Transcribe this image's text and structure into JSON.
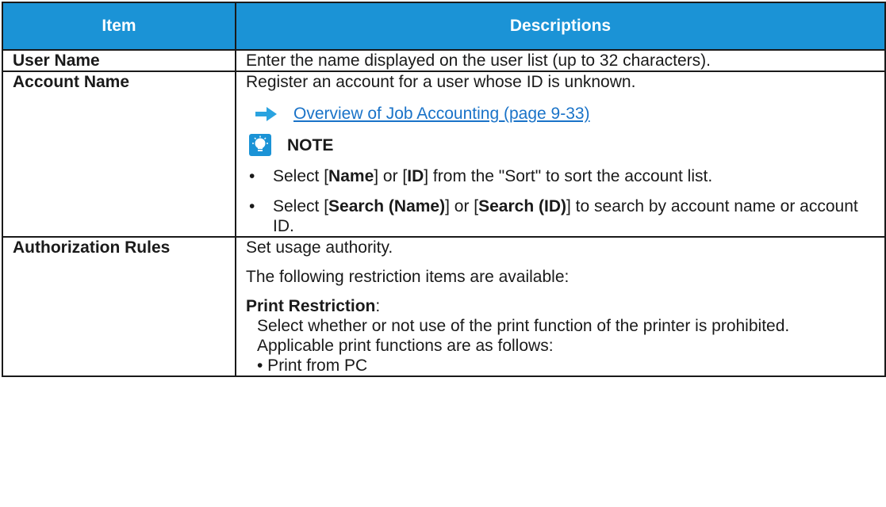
{
  "table": {
    "headers": {
      "item": "Item",
      "descriptions": "Descriptions"
    },
    "user_name": {
      "item": "User Name",
      "desc": "Enter the name displayed on the user list (up to 32 characters)."
    },
    "account_name": {
      "item": "Account Name",
      "desc": "Register an account for a user whose ID is unknown.",
      "link_text": "Overview of Job Accounting (page 9-33)",
      "note_label": "NOTE",
      "bullet1": {
        "pre": "Select [",
        "b1": "Name",
        "mid": "] or [",
        "b2": "ID",
        "post": "] from the \"Sort\" to sort the account list."
      },
      "bullet2": {
        "pre": "Select [",
        "b1": "Search (Name)",
        "mid": "] or [",
        "b2": "Search (ID)",
        "post": "] to search by account name or account ID."
      }
    },
    "authorization_rules": {
      "item": "Authorization Rules",
      "line1": "Set usage authority.",
      "line2": "The following restriction items are available:",
      "print_restriction_label": "Print Restriction",
      "print_restriction_colon": ":",
      "sub1": "Select whether or not use of the print function of the printer is prohibited.",
      "sub2": "Applicable print functions are as follows:",
      "sub3": "• Print from PC"
    }
  },
  "icons": {
    "arrow": "arrow-right-icon",
    "note": "note-lightbulb-icon"
  },
  "colors": {
    "header_bg": "#1b93d6",
    "link": "#1a73c8",
    "arrow": "#2aa3e0"
  }
}
